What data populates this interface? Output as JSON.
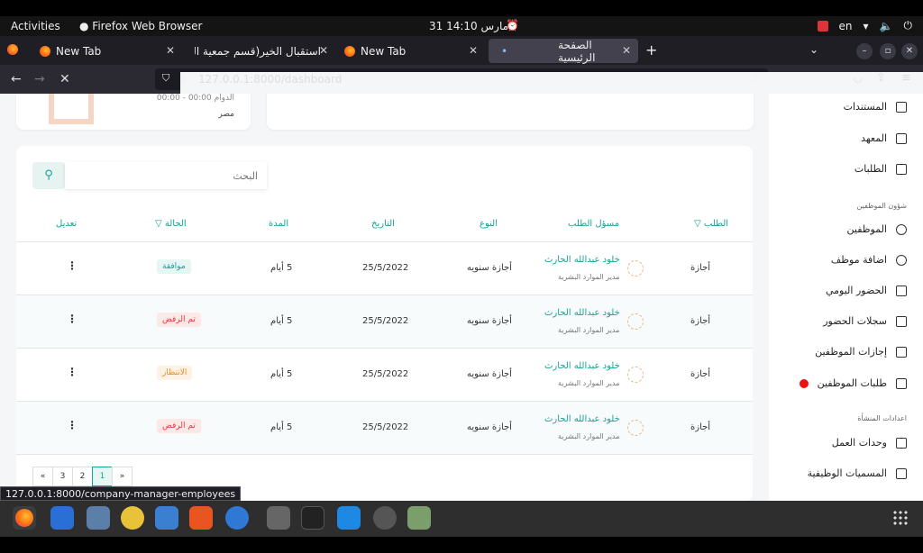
{
  "os": {
    "activities": "Activities",
    "app_name": "Firefox Web Browser",
    "clock": "31 مارس  14:10",
    "lang": "en"
  },
  "tabs": [
    {
      "title": "New Tab"
    },
    {
      "title": "استقبال الخير(قسم جمعية الدع"
    },
    {
      "title": "New Tab"
    },
    {
      "title": "الصفحة الرئيسية"
    }
  ],
  "url": "127.0.0.1:8000/dashboard",
  "sidebar": {
    "items_top": [
      "المستندات",
      "المعهد",
      "الطلبات"
    ],
    "section_employees": "شؤون الموظفين",
    "items_employees": [
      "الموظفين",
      "اضافة موظف",
      "الحضور اليومي",
      "سجلات الحضور",
      "إجازات الموظفين",
      "طلبات الموظفين"
    ],
    "section_settings": "اعدادات المنشأة",
    "items_settings": [
      "وحدات العمل",
      "المسميات الوظيفية"
    ]
  },
  "topcard": {
    "hours": "الدوام 00:00 - 00:00",
    "country": "مصر"
  },
  "search": {
    "placeholder": "البحث"
  },
  "table": {
    "headers": [
      "الطلب",
      "مسؤل الطلب",
      "النوع",
      "التاريخ",
      "المدة",
      "الحالة",
      "تعديل"
    ],
    "rows": [
      {
        "request": "أجازة",
        "name": "خلود عبدالله الحارث",
        "role": "مدير الموارد البشرية",
        "type": "أجازة سنويه",
        "date": "25/5/2022",
        "duration": "5 أيام",
        "status": "موافقة",
        "status_kind": "ok"
      },
      {
        "request": "أجازة",
        "name": "خلود عبدالله الحارث",
        "role": "مدير الموارد البشرية",
        "type": "أجازة سنويه",
        "date": "25/5/2022",
        "duration": "5 أيام",
        "status": "تم الرفض",
        "status_kind": "rej"
      },
      {
        "request": "أجازة",
        "name": "خلود عبدالله الحارث",
        "role": "مدير الموارد البشرية",
        "type": "أجازة سنويه",
        "date": "25/5/2022",
        "duration": "5 أيام",
        "status": "الانتظار",
        "status_kind": "wait"
      },
      {
        "request": "أجازة",
        "name": "خلود عبدالله الحارث",
        "role": "مدير الموارد البشرية",
        "type": "أجازة سنويه",
        "date": "25/5/2022",
        "duration": "5 أيام",
        "status": "تم الرفض",
        "status_kind": "rej"
      }
    ]
  },
  "pagination": [
    "«",
    "3",
    "2",
    "1",
    "»"
  ],
  "pagination_current": "1",
  "status_url": "127.0.0.1:8000/company-manager-employees",
  "accent": "#17a395"
}
